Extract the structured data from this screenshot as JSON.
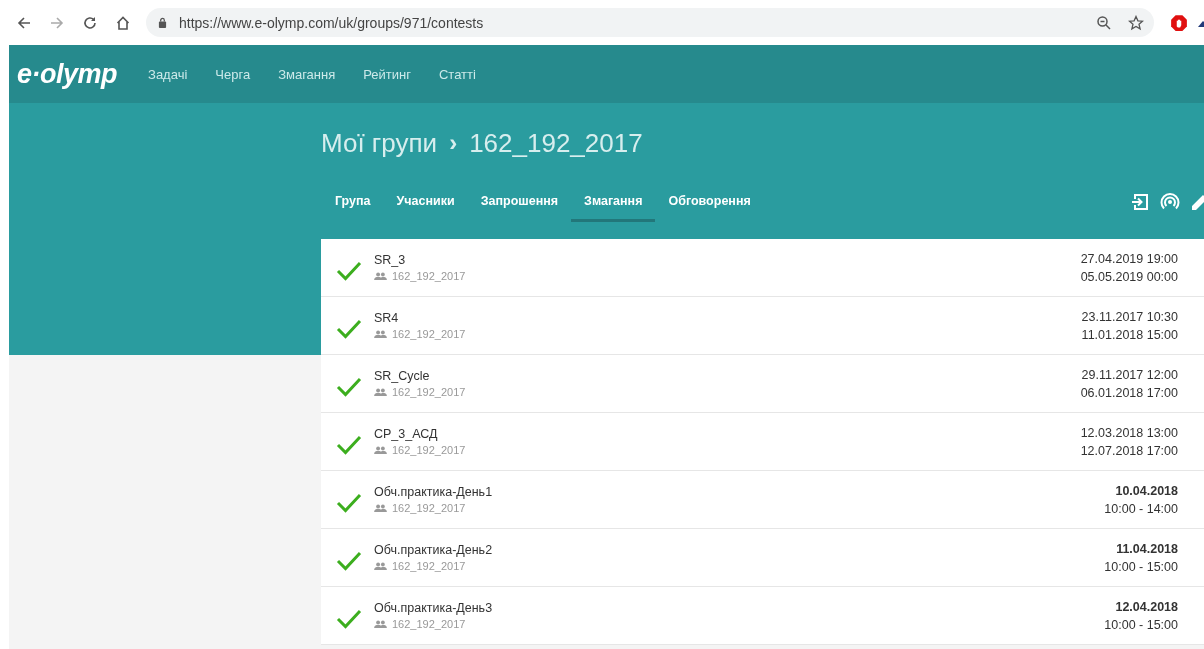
{
  "browser": {
    "url": "https://www.e-olymp.com/uk/groups/971/contests"
  },
  "header": {
    "logo": "e·olymp",
    "nav": [
      {
        "label": "Задачі"
      },
      {
        "label": "Черга"
      },
      {
        "label": "Змагання"
      },
      {
        "label": "Рейтинг"
      },
      {
        "label": "Статті"
      }
    ]
  },
  "breadcrumb": {
    "parent": "Мої групи",
    "separator": "›",
    "current": "162_192_2017"
  },
  "tabs": [
    {
      "label": "Група",
      "selected": false
    },
    {
      "label": "Учасники",
      "selected": false
    },
    {
      "label": "Запрошення",
      "selected": false
    },
    {
      "label": "Змагання",
      "selected": true
    },
    {
      "label": "Обговорення",
      "selected": false
    }
  ],
  "contests": [
    {
      "name": "SR_3",
      "group": "162_192_2017",
      "solved": true,
      "kind": "range",
      "line_1": "27.04.2019 19:00",
      "line_2": "05.05.2019 00:00"
    },
    {
      "name": "SR4",
      "group": "162_192_2017",
      "solved": true,
      "kind": "range",
      "line_1": "23.11.2017 10:30",
      "line_2": "11.01.2018 15:00"
    },
    {
      "name": "SR_Cycle",
      "group": "162_192_2017",
      "solved": true,
      "kind": "range",
      "line_1": "29.11.2017 12:00",
      "line_2": "06.01.2018 17:00"
    },
    {
      "name": "CP_3_АСД",
      "group": "162_192_2017",
      "solved": true,
      "kind": "range",
      "line_1": "12.03.2018 13:00",
      "line_2": "12.07.2018 17:00"
    },
    {
      "name": "Обч.практика-День1",
      "group": "162_192_2017",
      "solved": true,
      "kind": "day",
      "line_1": "10.04.2018",
      "line_2": "10:00 - 14:00"
    },
    {
      "name": "Обч.практика-День2",
      "group": "162_192_2017",
      "solved": true,
      "kind": "day",
      "line_1": "11.04.2018",
      "line_2": "10:00 - 15:00"
    },
    {
      "name": "Обч.практика-День3",
      "group": "162_192_2017",
      "solved": true,
      "kind": "day",
      "line_1": "12.04.2018",
      "line_2": "10:00 - 15:00"
    }
  ]
}
